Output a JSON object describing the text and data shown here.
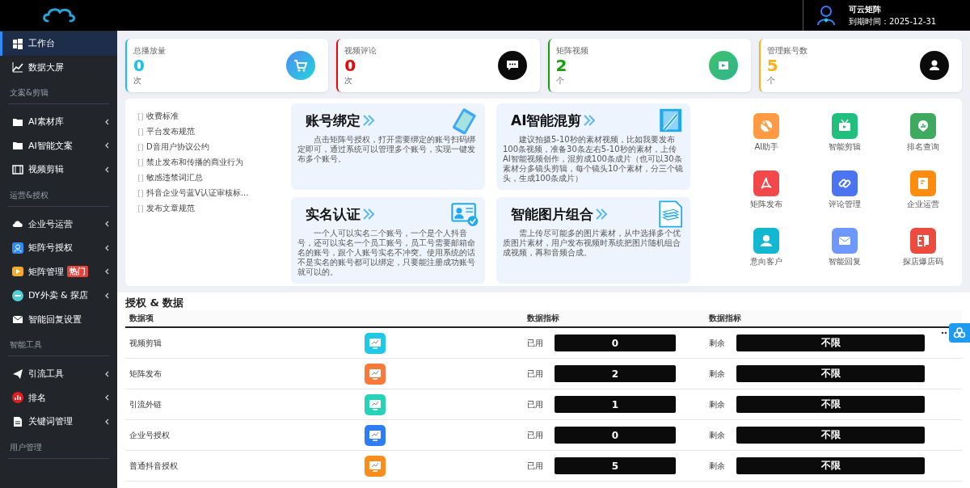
{
  "header": {
    "user_name": "可云矩阵",
    "expiry": "到期时间：2025-12-31"
  },
  "sidebar": {
    "items": [
      {
        "kind": "item",
        "label": "工作台",
        "selected": true,
        "expandable": false
      },
      {
        "kind": "item",
        "label": "数据大屏",
        "selected": false,
        "expandable": false
      },
      {
        "kind": "section",
        "label": "文案&剪辑"
      },
      {
        "kind": "item",
        "label": "AI素材库",
        "selected": false,
        "expandable": true
      },
      {
        "kind": "item",
        "label": "AI智能文案",
        "selected": false,
        "expandable": true
      },
      {
        "kind": "item",
        "label": "视频剪辑",
        "selected": false,
        "expandable": true
      },
      {
        "kind": "section",
        "label": "运营&授权"
      },
      {
        "kind": "item",
        "label": "企业号运营",
        "selected": false,
        "expandable": true
      },
      {
        "kind": "item",
        "label": "矩阵号授权",
        "selected": false,
        "expandable": true
      },
      {
        "kind": "item",
        "label": "矩阵管理",
        "selected": false,
        "expandable": true,
        "badge": "热门"
      },
      {
        "kind": "item",
        "label": "DY外卖 & 探店",
        "selected": false,
        "expandable": true
      },
      {
        "kind": "item",
        "label": "智能回复设置",
        "selected": false,
        "expandable": false
      },
      {
        "kind": "section",
        "label": "智能工具"
      },
      {
        "kind": "item",
        "label": "引流工具",
        "selected": false,
        "expandable": true
      },
      {
        "kind": "item",
        "label": "排名",
        "selected": false,
        "expandable": true
      },
      {
        "kind": "item",
        "label": "关键词管理",
        "selected": false,
        "expandable": true
      },
      {
        "kind": "section",
        "label": "用户管理"
      }
    ]
  },
  "stats": [
    {
      "label": "总播放量",
      "value": "0",
      "unit": "次",
      "color": "#17c1e8",
      "kind": "cart"
    },
    {
      "label": "视频评论",
      "value": "0",
      "unit": "次",
      "color": "#ea0606",
      "kind": "chat"
    },
    {
      "label": "矩阵视频",
      "value": "2",
      "unit": "个",
      "color": "#17a00e",
      "kind": "film"
    },
    {
      "label": "管理账号数",
      "value": "5",
      "unit": "个",
      "color": "#fbb117",
      "kind": "user"
    }
  ],
  "notices": [
    "收费标准",
    "平台发布规范",
    "D音用户协议公约",
    "禁止发布和传播的商业行为",
    "敏感违禁词汇总",
    "抖音企业号蓝V认证审核标...",
    "发布文章规范"
  ],
  "guides": [
    {
      "title": "账号绑定",
      "text": "点击矩阵号授权，打开需要绑定的账号扫码绑定即可，通过系统可以管理多个账号，实现一键发布多个账号。",
      "kind": "phone"
    },
    {
      "title": "AI智能混剪",
      "text": "建议拍摄5-10秒的素材视频，比如我要发布100条视频，准备30条左右5-10秒的素材，上传AI智能视频创作，混剪成100条成片（也可以30条素材分多镜头剪辑，每个镜头10个素材，分三个镜头，生成100条成片）",
      "kind": "film"
    },
    {
      "title": "实名认证",
      "text": "一个人可以实名二个账号，一个是个人抖音号，还可以实名一个员工账号，员工号需要邮箱命名的账号，跟个人账号实名不冲突。使用系统的话不是实名的账号都可以绑定，只要能注册成功账号就可以的。",
      "kind": "idcard"
    },
    {
      "title": "智能图片组合",
      "text": "需上传尽可能多的图片素材，从中选择多个优质图片素材，用户发布视频时系统把图片随机组合成视频，再和音频合成。",
      "kind": "doc"
    }
  ],
  "shortcuts": [
    {
      "label": "AI助手",
      "color": "#ff9a42"
    },
    {
      "label": "智能剪辑",
      "color": "#21bf7e"
    },
    {
      "label": "排名查询",
      "color": "#3daa5f"
    },
    {
      "label": "矩阵发布",
      "color": "#f2474b"
    },
    {
      "label": "评论管理",
      "color": "#4a74f0"
    },
    {
      "label": "企业运营",
      "color": "#ff8c0f"
    },
    {
      "label": "意向客户",
      "color": "#12b8d0"
    },
    {
      "label": "智能回复",
      "color": "#6e97ff"
    },
    {
      "label": "探店爆店码",
      "color": "#ee4b3f"
    }
  ],
  "table": {
    "title": "授权 & 数据",
    "columns": [
      "数据项",
      "数据指标",
      "数据指标"
    ],
    "rows": [
      {
        "name": "视频剪辑",
        "color": "#1ec8e6",
        "used_label": "已用",
        "used": "0",
        "left_label": "剩余",
        "left": "不限"
      },
      {
        "name": "矩阵发布",
        "color": "#f8793a",
        "used_label": "已用",
        "used": "2",
        "left_label": "剩余",
        "left": "不限"
      },
      {
        "name": "引流外链",
        "color": "#27d3b8",
        "used_label": "已用",
        "used": "1",
        "left_label": "剩余",
        "left": "不限"
      },
      {
        "name": "企业号授权",
        "color": "#2f7df6",
        "used_label": "已用",
        "used": "0",
        "left_label": "剩余",
        "left": "不限"
      },
      {
        "name": "普通抖音授权",
        "color": "#fa8d1b",
        "used_label": "已用",
        "used": "5",
        "left_label": "剩余",
        "left": "不限"
      }
    ]
  }
}
